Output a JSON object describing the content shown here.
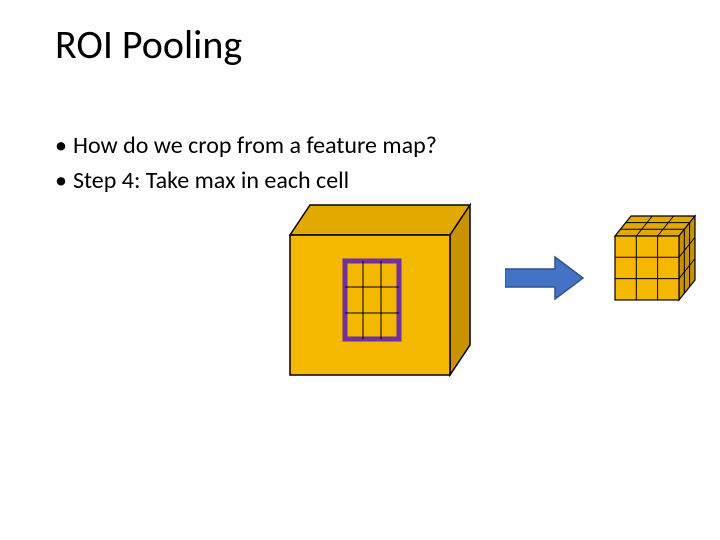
{
  "title": "ROI Pooling",
  "bullets": [
    "How do we crop from a feature map?",
    "Step 4: Take max in each cell"
  ],
  "colors": {
    "cube_top": "#e2a900",
    "cube_front": "#f5b800",
    "cube_side": "#c99200",
    "cube_stroke": "#000000",
    "roi_outline": "#7030a0",
    "roi_fill": "#f5b800",
    "arrow": "#4472c4"
  },
  "diagram": {
    "left_cube": "large 3D feature map block",
    "roi_region": "3×3 purple-outlined grid region on front face",
    "arrow": "right-pointing block arrow",
    "right_cube": "small 3×3×3 cube (pooled output)"
  }
}
